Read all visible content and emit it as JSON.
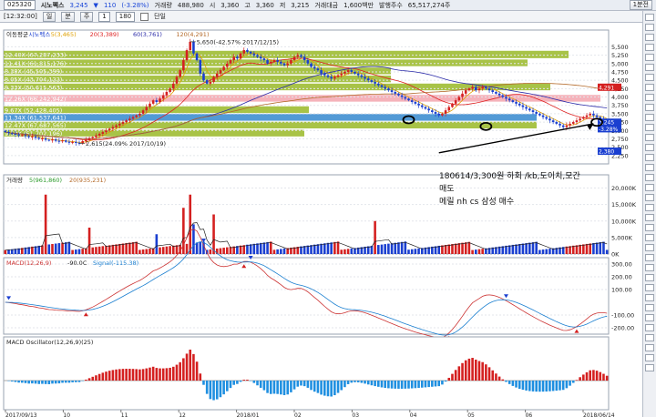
{
  "window": {
    "code": "025320",
    "time": "[12:32:00]",
    "name": "시노펙스",
    "mode": "1분전"
  },
  "quote": {
    "price": "3,245",
    "arrow": "▼",
    "change": "110",
    "pct": "(-3.28%)",
    "volume_label": "거래량",
    "volume": "488,980",
    "open_label": "시",
    "open": "3,360",
    "high_label": "고",
    "high": "3,360",
    "low_label": "저",
    "low": "3,215",
    "amount_label": "거래대금",
    "amount": "1,600백만",
    "shares_label": "발행주수",
    "shares": "65,517,274주"
  },
  "toolbar": {
    "period_day": "일",
    "period_min": "분",
    "period_week": "주",
    "count": "180",
    "unit": "1",
    "check_label": "단일"
  },
  "colors": {
    "up": "#d42020",
    "down": "#1a3fd0",
    "green_band": "#9fbd33",
    "red_band": "#f4aab2",
    "blue_band": "#3f8fd2"
  },
  "annotation": {
    "line1": "180614/3,300원 하회 /kb,도이치,모간",
    "line2": "매도",
    "line3": "메릴 nh cs 삼성 매수"
  },
  "chart_data": [
    {
      "type": "candlestick",
      "title": "",
      "legend": [
        "이동평균",
        "시노펙스",
        "5(3,465)",
        "20(3,389)",
        "60(3,761)",
        "120(4,291)"
      ],
      "x_dates": [
        "2017/09/13",
        "10",
        "11",
        "12",
        "2018/01",
        "02",
        "03",
        "04",
        "05",
        "06",
        "2018/06/14"
      ],
      "ylim": [
        2000,
        6000
      ],
      "yticks": [
        2250,
        2500,
        2750,
        3000,
        3250,
        3500,
        3750,
        4000,
        4250,
        4500,
        4750,
        5000,
        5250,
        5500
      ],
      "bands": [
        {
          "label": "12.40X (67,287,233)",
          "low": 5160,
          "high": 5380,
          "color": "green"
        },
        {
          "label": "11.41X (61,815,176)",
          "low": 4920,
          "high": 5120,
          "color": "green"
        },
        {
          "label": "8.38X (45,505,399)",
          "low": 4680,
          "high": 4880,
          "color": "green"
        },
        {
          "label": "8.05X (43,704,122)",
          "low": 4440,
          "high": 4640,
          "color": "green"
        },
        {
          "label": "9.33X (50,615,563)",
          "low": 4200,
          "high": 4400,
          "color": "green"
        },
        {
          "label": "12.26X (66,242,942)",
          "low": 3860,
          "high": 4060,
          "color": "red"
        },
        {
          "label": "9.67X (52,428,405)",
          "low": 3520,
          "high": 3720,
          "color": "green"
        },
        {
          "label": "11.34X (61,537,641)",
          "low": 3290,
          "high": 3490,
          "color": "blue"
        },
        {
          "label": "12.47X (67,687,565)",
          "low": 3060,
          "high": 3260,
          "color": "green"
        },
        {
          "label": "9.52X (51,702,196)",
          "low": 2820,
          "high": 3020,
          "color": "green"
        }
      ],
      "annotations": [
        {
          "text": "5,650(-42.57% 2017/12/15)",
          "x_index": 55,
          "y": 5650
        },
        {
          "text": "2,615(24.09% 2017/10/19)",
          "x_index": 22,
          "y": 2615
        }
      ],
      "right_labels": [
        {
          "text": "4,291",
          "y": 4291,
          "color": "red"
        },
        {
          "text": "3,245",
          "y": 3245,
          "color": "blue"
        },
        {
          "text": "-3.28%",
          "y": 3050,
          "color": "blue"
        },
        {
          "text": "2,380",
          "y": 2380,
          "color": "blue"
        }
      ],
      "close": [
        2950,
        2920,
        2900,
        2880,
        2850,
        2860,
        2830,
        2800,
        2820,
        2780,
        2750,
        2760,
        2720,
        2700,
        2730,
        2690,
        2680,
        2700,
        2660,
        2640,
        2655,
        2630,
        2615,
        2680,
        2720,
        2760,
        2800,
        2850,
        2900,
        2950,
        3000,
        3050,
        3100,
        3150,
        3200,
        3250,
        3300,
        3350,
        3400,
        3450,
        3500,
        3600,
        3700,
        3800,
        3900,
        3850,
        3950,
        4050,
        4150,
        4250,
        4400,
        4600,
        4800,
        5100,
        5400,
        5650,
        5300,
        5100,
        4700,
        4500,
        4400,
        4450,
        4600,
        4700,
        4800,
        4900,
        5000,
        5100,
        5200,
        5150,
        5300,
        5400,
        5350,
        5300,
        5250,
        5200,
        5150,
        5100,
        5000,
        5050,
        5100,
        5050,
        5000,
        4950,
        5000,
        5100,
        5200,
        5250,
        5200,
        5100,
        5000,
        4900,
        4850,
        4800,
        4700,
        4650,
        4600,
        4550,
        4600,
        4650,
        4700,
        4750,
        4800,
        4750,
        4700,
        4650,
        4600,
        4550,
        4500,
        4450,
        4400,
        4350,
        4300,
        4250,
        4200,
        4150,
        4100,
        4050,
        4000,
        3950,
        3900,
        3850,
        3800,
        3750,
        3700,
        3650,
        3600,
        3550,
        3500,
        3450,
        3500,
        3600,
        3700,
        3800,
        3900,
        4000,
        4100,
        4200,
        4250,
        4300,
        4200,
        4250,
        4300,
        4250,
        4200,
        4150,
        4100,
        4050,
        4000,
        3950,
        3900,
        3850,
        3800,
        3750,
        3700,
        3650,
        3600,
        3550,
        3500,
        3450,
        3400,
        3350,
        3300,
        3250,
        3200,
        3150,
        3100,
        3150,
        3200,
        3250,
        3300,
        3350,
        3400,
        3450,
        3500,
        3450,
        3400,
        3350,
        3300,
        3245
      ]
    },
    {
      "type": "bar",
      "title": "거래량",
      "legend": [
        "5(961,860)",
        "20(935,231)"
      ],
      "yticks": [
        "20,000K",
        "15,000K",
        "10,000K",
        "5,000K",
        "0K"
      ],
      "ylim": [
        0,
        24000
      ],
      "spikes": [
        {
          "x_index": 12,
          "value": 18000,
          "color": "red"
        },
        {
          "x_index": 53,
          "value": 14000,
          "color": "red"
        },
        {
          "x_index": 55,
          "value": 18000,
          "color": "red"
        },
        {
          "x_index": 56,
          "value": 9000,
          "color": "blue"
        },
        {
          "x_index": 62,
          "value": 12000,
          "color": "red"
        },
        {
          "x_index": 110,
          "value": 10000,
          "color": "red"
        },
        {
          "x_index": 45,
          "value": 6000,
          "color": "blue"
        },
        {
          "x_index": 25,
          "value": 8000,
          "color": "red"
        }
      ]
    },
    {
      "type": "line",
      "title": "MACD(12,26,9)",
      "series_labels": [
        "MACD(12,26,9)",
        "-90.0C",
        "Signal(-115.38)"
      ],
      "yticks": [
        300,
        200,
        100,
        -100,
        -200
      ],
      "ylim": [
        -250,
        350
      ],
      "macd_cycle": "derived from close"
    },
    {
      "type": "bar",
      "title": "MACD Oscillator(12,26,9)(25)",
      "yticks": [],
      "oscillator_cycle": "derived from close"
    }
  ]
}
